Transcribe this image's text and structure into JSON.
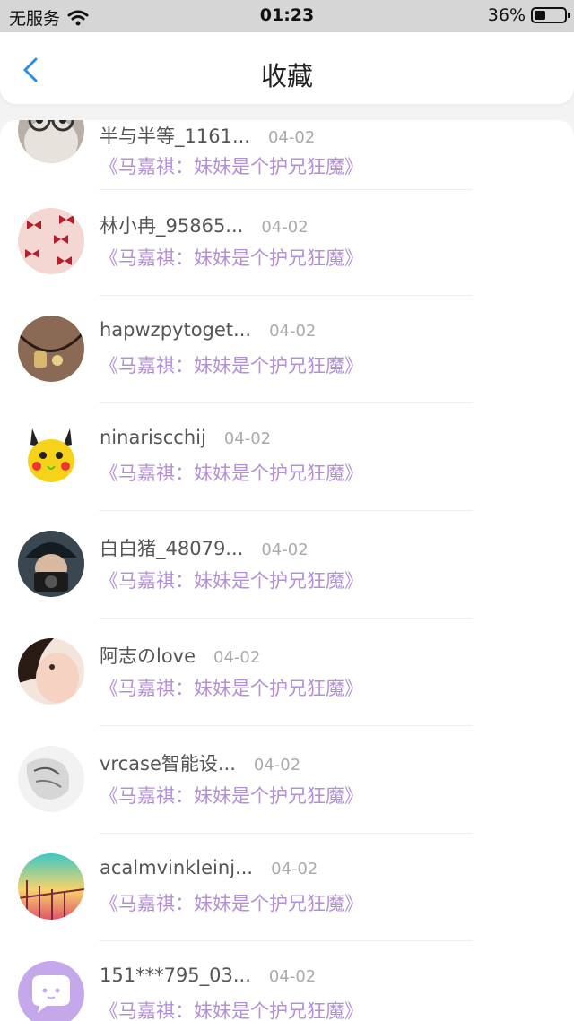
{
  "status_bar": {
    "carrier": "无服务",
    "time": "01:23",
    "battery": "36%",
    "battery_level": 0.36
  },
  "nav": {
    "title": "收藏",
    "back_icon": "chevron-left-icon",
    "accent_color": "#2a8de8"
  },
  "favorites": [
    {
      "name": "半与半等_1161...",
      "date": "04-02",
      "content": "《马嘉祺：妹妹是个护兄狂魔》",
      "avatar": "avatar-glasses"
    },
    {
      "name": "林小冉_95865...",
      "date": "04-02",
      "content": "《马嘉祺：妹妹是个护兄狂魔》",
      "avatar": "avatar-bows"
    },
    {
      "name": "hapwzpytoget...",
      "date": "04-02",
      "content": "《马嘉祺：妹妹是个护兄狂魔》",
      "avatar": "avatar-pendant"
    },
    {
      "name": "ninariscchij",
      "date": "04-02",
      "content": "《马嘉祺：妹妹是个护兄狂魔》",
      "avatar": "avatar-pikachu"
    },
    {
      "name": "白白猪_48079...",
      "date": "04-02",
      "content": "《马嘉祺：妹妹是个护兄狂魔》",
      "avatar": "avatar-camera"
    },
    {
      "name": "阿志のlove",
      "date": "04-02",
      "content": "《马嘉祺：妹妹是个护兄狂魔》",
      "avatar": "avatar-face"
    },
    {
      "name": "vrcase智能设...",
      "date": "04-02",
      "content": "《马嘉祺：妹妹是个护兄狂魔》",
      "avatar": "avatar-sketch"
    },
    {
      "name": "acalmvinkleinj...",
      "date": "04-02",
      "content": "《马嘉祺：妹妹是个护兄狂魔》",
      "avatar": "avatar-sunset"
    },
    {
      "name": "151***795_03...",
      "date": "04-02",
      "content": "《马嘉祺：妹妹是个护兄狂魔》",
      "avatar": "avatar-default-chat"
    }
  ],
  "colors": {
    "content_text": "#b48fd8",
    "name_text": "#555555",
    "date_text": "#aaaaaa"
  }
}
